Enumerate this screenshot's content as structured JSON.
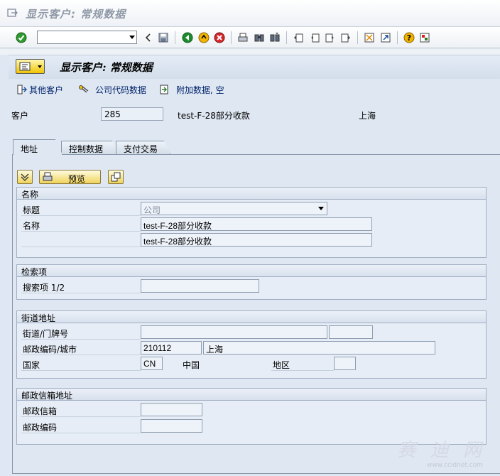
{
  "window": {
    "title": "显示客户: 常规数据"
  },
  "system_toolbar": {
    "command_field_value": "",
    "icons": [
      "enter-icon",
      "back-icon",
      "save-icon",
      "back-green-icon",
      "exit-icon",
      "cancel-icon",
      "print-icon",
      "find-icon",
      "find-next-icon",
      "first-page-icon",
      "prev-page-icon",
      "next-page-icon",
      "last-page-icon",
      "new-session-icon",
      "shortcut-icon",
      "help-icon",
      "layout-menu-icon"
    ]
  },
  "screen": {
    "title": "显示客户: 常规数据"
  },
  "app_toolbar": {
    "other_customer": "其他客户",
    "company_code_data": "公司代码数据",
    "additional_data": "附加数据, 空"
  },
  "header": {
    "customer_label": "客户",
    "customer_number": "285",
    "customer_name": "test-F-28部分收款",
    "city": "上海"
  },
  "tabs": [
    {
      "label": "地址",
      "active": true
    },
    {
      "label": "控制数据",
      "active": false
    },
    {
      "label": "支付交易",
      "active": false
    }
  ],
  "panel_buttons": {
    "preview": "预览"
  },
  "name_group": {
    "title": "名称",
    "title_label": "标题",
    "title_value": "公司",
    "name_label": "名称",
    "name1": "test-F-28部分收款",
    "name2": "test-F-28部分收款"
  },
  "search_group": {
    "title": "检索项",
    "search_label": "搜索项 1/2",
    "search_value": ""
  },
  "street_group": {
    "title": "街道地址",
    "street_label": "街道/门牌号",
    "street_value": "",
    "house_value": "",
    "postal_city_label": "邮政编码/城市",
    "postal_code": "210112",
    "city": "上海",
    "country_label": "国家",
    "country_code": "CN",
    "country_name": "中国",
    "region_label": "地区",
    "region_value": ""
  },
  "pobox_group": {
    "title": "邮政信箱地址",
    "pobox_label": "邮政信箱",
    "pobox_value": "",
    "postal_code_label": "邮政编码",
    "postal_code_value": ""
  },
  "watermark": {
    "text": "赛 迪 网",
    "url": "www.ccidnet.com"
  },
  "colors": {
    "accent": "#f1c400",
    "background": "#dfe7f2",
    "link": "#00236b"
  }
}
